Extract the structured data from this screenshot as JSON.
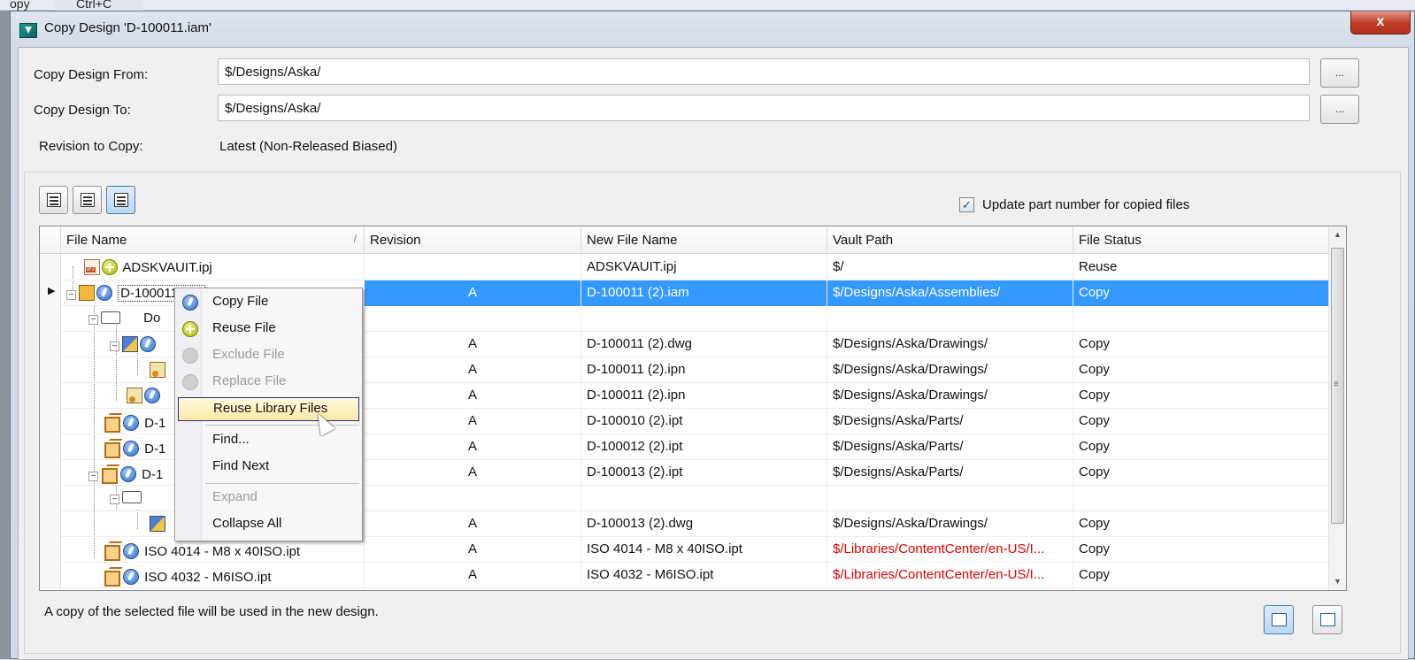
{
  "menu_hint": {
    "copy": "opy",
    "shortcut": "Ctrl+C"
  },
  "window": {
    "title": "Copy Design 'D-100011.iam'",
    "close_label": "x"
  },
  "form": {
    "from_label": "Copy Design From:",
    "from_value": "$/Designs/Aska/",
    "to_label": "Copy Design To:",
    "to_value": "$/Designs/Aska/",
    "browse_label": "...",
    "revision_label": "Revision to Copy:",
    "revision_value": "Latest (Non-Released Biased)"
  },
  "options": {
    "update_part_number_label": "Update part number for copied files",
    "update_part_number_checked": true
  },
  "grid": {
    "columns": [
      "File Name",
      "Revision",
      "New File Name",
      "Vault Path",
      "File Status"
    ],
    "sort_glyph": "/",
    "rows": [
      {
        "name": "ADSKVAUIT.ipj",
        "revision": "",
        "new_name": "ADSKVAUIT.ipj",
        "vault_path": "$/",
        "status": "Reuse"
      },
      {
        "name": "D-100011.iam",
        "revision": "A",
        "new_name": "D-100011 (2).iam",
        "vault_path": "$/Designs/Aska/Assemblies/",
        "status": "Copy",
        "selected": true
      },
      {
        "name": "Do",
        "revision": "",
        "new_name": "",
        "vault_path": "",
        "status": ""
      },
      {
        "name": "",
        "revision": "A",
        "new_name": "D-100011 (2).dwg",
        "vault_path": "$/Designs/Aska/Drawings/",
        "status": "Copy"
      },
      {
        "name": "",
        "revision": "A",
        "new_name": "D-100011 (2).ipn",
        "vault_path": "$/Designs/Aska/Drawings/",
        "status": "Copy"
      },
      {
        "name": "",
        "revision": "A",
        "new_name": "D-100011 (2).ipn",
        "vault_path": "$/Designs/Aska/Drawings/",
        "status": "Copy"
      },
      {
        "name": "D-1",
        "revision": "A",
        "new_name": "D-100010 (2).ipt",
        "vault_path": "$/Designs/Aska/Parts/",
        "status": "Copy"
      },
      {
        "name": "D-1",
        "revision": "A",
        "new_name": "D-100012 (2).ipt",
        "vault_path": "$/Designs/Aska/Parts/",
        "status": "Copy"
      },
      {
        "name": "D-1",
        "revision": "A",
        "new_name": "D-100013 (2).ipt",
        "vault_path": "$/Designs/Aska/Parts/",
        "status": "Copy"
      },
      {
        "name": "",
        "revision": "",
        "new_name": "",
        "vault_path": "",
        "status": ""
      },
      {
        "name": "",
        "revision": "A",
        "new_name": "D-100013 (2).dwg",
        "vault_path": "$/Designs/Aska/Drawings/",
        "status": "Copy"
      },
      {
        "name": "ISO 4014 - M8 x 40ISO.ipt",
        "revision": "A",
        "new_name": "ISO 4014 - M8 x 40ISO.ipt",
        "vault_path": "$/Libraries/ContentCenter/en-US/I...",
        "status": "Copy",
        "path_red": true
      },
      {
        "name": "ISO 4032 - M6ISO.ipt",
        "revision": "A",
        "new_name": "ISO 4032 - M6ISO.ipt",
        "vault_path": "$/Libraries/ContentCenter/en-US/I...",
        "status": "Copy",
        "path_red": true
      }
    ]
  },
  "context_menu": {
    "items": [
      {
        "label": "Copy File",
        "icon": "copy-icon",
        "disabled": false
      },
      {
        "label": "Reuse File",
        "icon": "reuse-icon",
        "disabled": false
      },
      {
        "label": "Exclude File",
        "icon": "exclude-icon",
        "disabled": true
      },
      {
        "label": "Replace File",
        "icon": "replace-icon",
        "disabled": true
      },
      {
        "label": "Reuse Library Files",
        "icon": "",
        "disabled": false,
        "hover": true
      },
      {
        "label": "Find...",
        "icon": "",
        "disabled": false
      },
      {
        "label": "Find Next",
        "icon": "",
        "disabled": false
      },
      {
        "label": "Expand",
        "icon": "",
        "disabled": true
      },
      {
        "label": "Collapse All",
        "icon": "",
        "disabled": false
      }
    ]
  },
  "status_text": "A copy of the selected file will be used in the new design.",
  "colors": {
    "selection": "#3399ff",
    "library_path": "#e00000",
    "menu_hover": "#fde9a6"
  }
}
